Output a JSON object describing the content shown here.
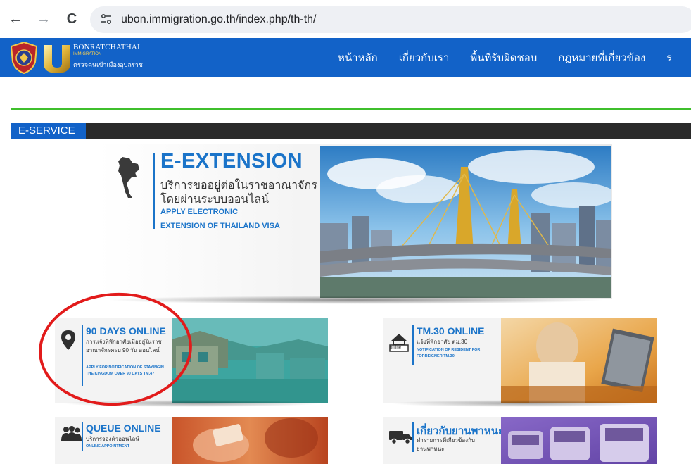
{
  "browser": {
    "back_icon": "←",
    "forward_icon": "→",
    "reload_icon": "C",
    "site_info_icon": "⚙",
    "url": "ubon.immigration.go.th/index.php/th-th/"
  },
  "header": {
    "logo_name": "BONRATCHATHAI",
    "logo_sub": "IMMIGRATION",
    "logo_thai": "ตรวจคนเข้าเมืองอุบลราช",
    "nav": [
      {
        "label": "หน้าหลัก"
      },
      {
        "label": "เกี่ยวกับเรา"
      },
      {
        "label": "พื้นที่รับผิดชอบ"
      },
      {
        "label": "กฎหมายที่เกี่ยวข้อง"
      }
    ],
    "nav_more": "ร"
  },
  "section": {
    "label": "E-SERVICE"
  },
  "extension": {
    "title": "E-EXTENSION",
    "thai_line1": "บริการขออยู่ต่อในราชอาณาจักร",
    "thai_line2": "โดยผ่านระบบออนไลน์",
    "en_line1": "APPLY ELECTRONIC",
    "en_line2": "EXTENSION OF THAILAND VISA"
  },
  "cards": {
    "ninety_days": {
      "title": "90 DAYS ONLINE",
      "thai": "การแจ้งที่พักอาศัยเมื่ออยู่ในราชอาณาจักรครบ 90 วัน ออนไลน์",
      "en": "APPLY FOR NOTIFICATION OF STAYINGIN THE KINGDOM OVER 90 DAYS TM.47"
    },
    "tm30": {
      "title": "TM.30 ONLINE",
      "thai": "แจ้งที่พักอาศัย ตม.30",
      "en": "NOTIFICATION OF RESIDENT FOR FORREIGNER TM.30",
      "icon_label": "online"
    },
    "queue": {
      "title": "QUEUE ONLINE",
      "thai": "บริการจองคิวออนไลน์",
      "en": "ONLINE APPOINTMENT"
    },
    "vehicle": {
      "title": "เกี่ยวกับยานพาหนะ",
      "thai": "ทำรายการที่เกี่ยวข้องกับยานพาหนะ"
    }
  },
  "colors": {
    "brand_blue": "#1262c8",
    "accent_blue": "#1b74c9",
    "green_rule": "#3fbf2c",
    "annotation_red": "#e21b1b"
  }
}
